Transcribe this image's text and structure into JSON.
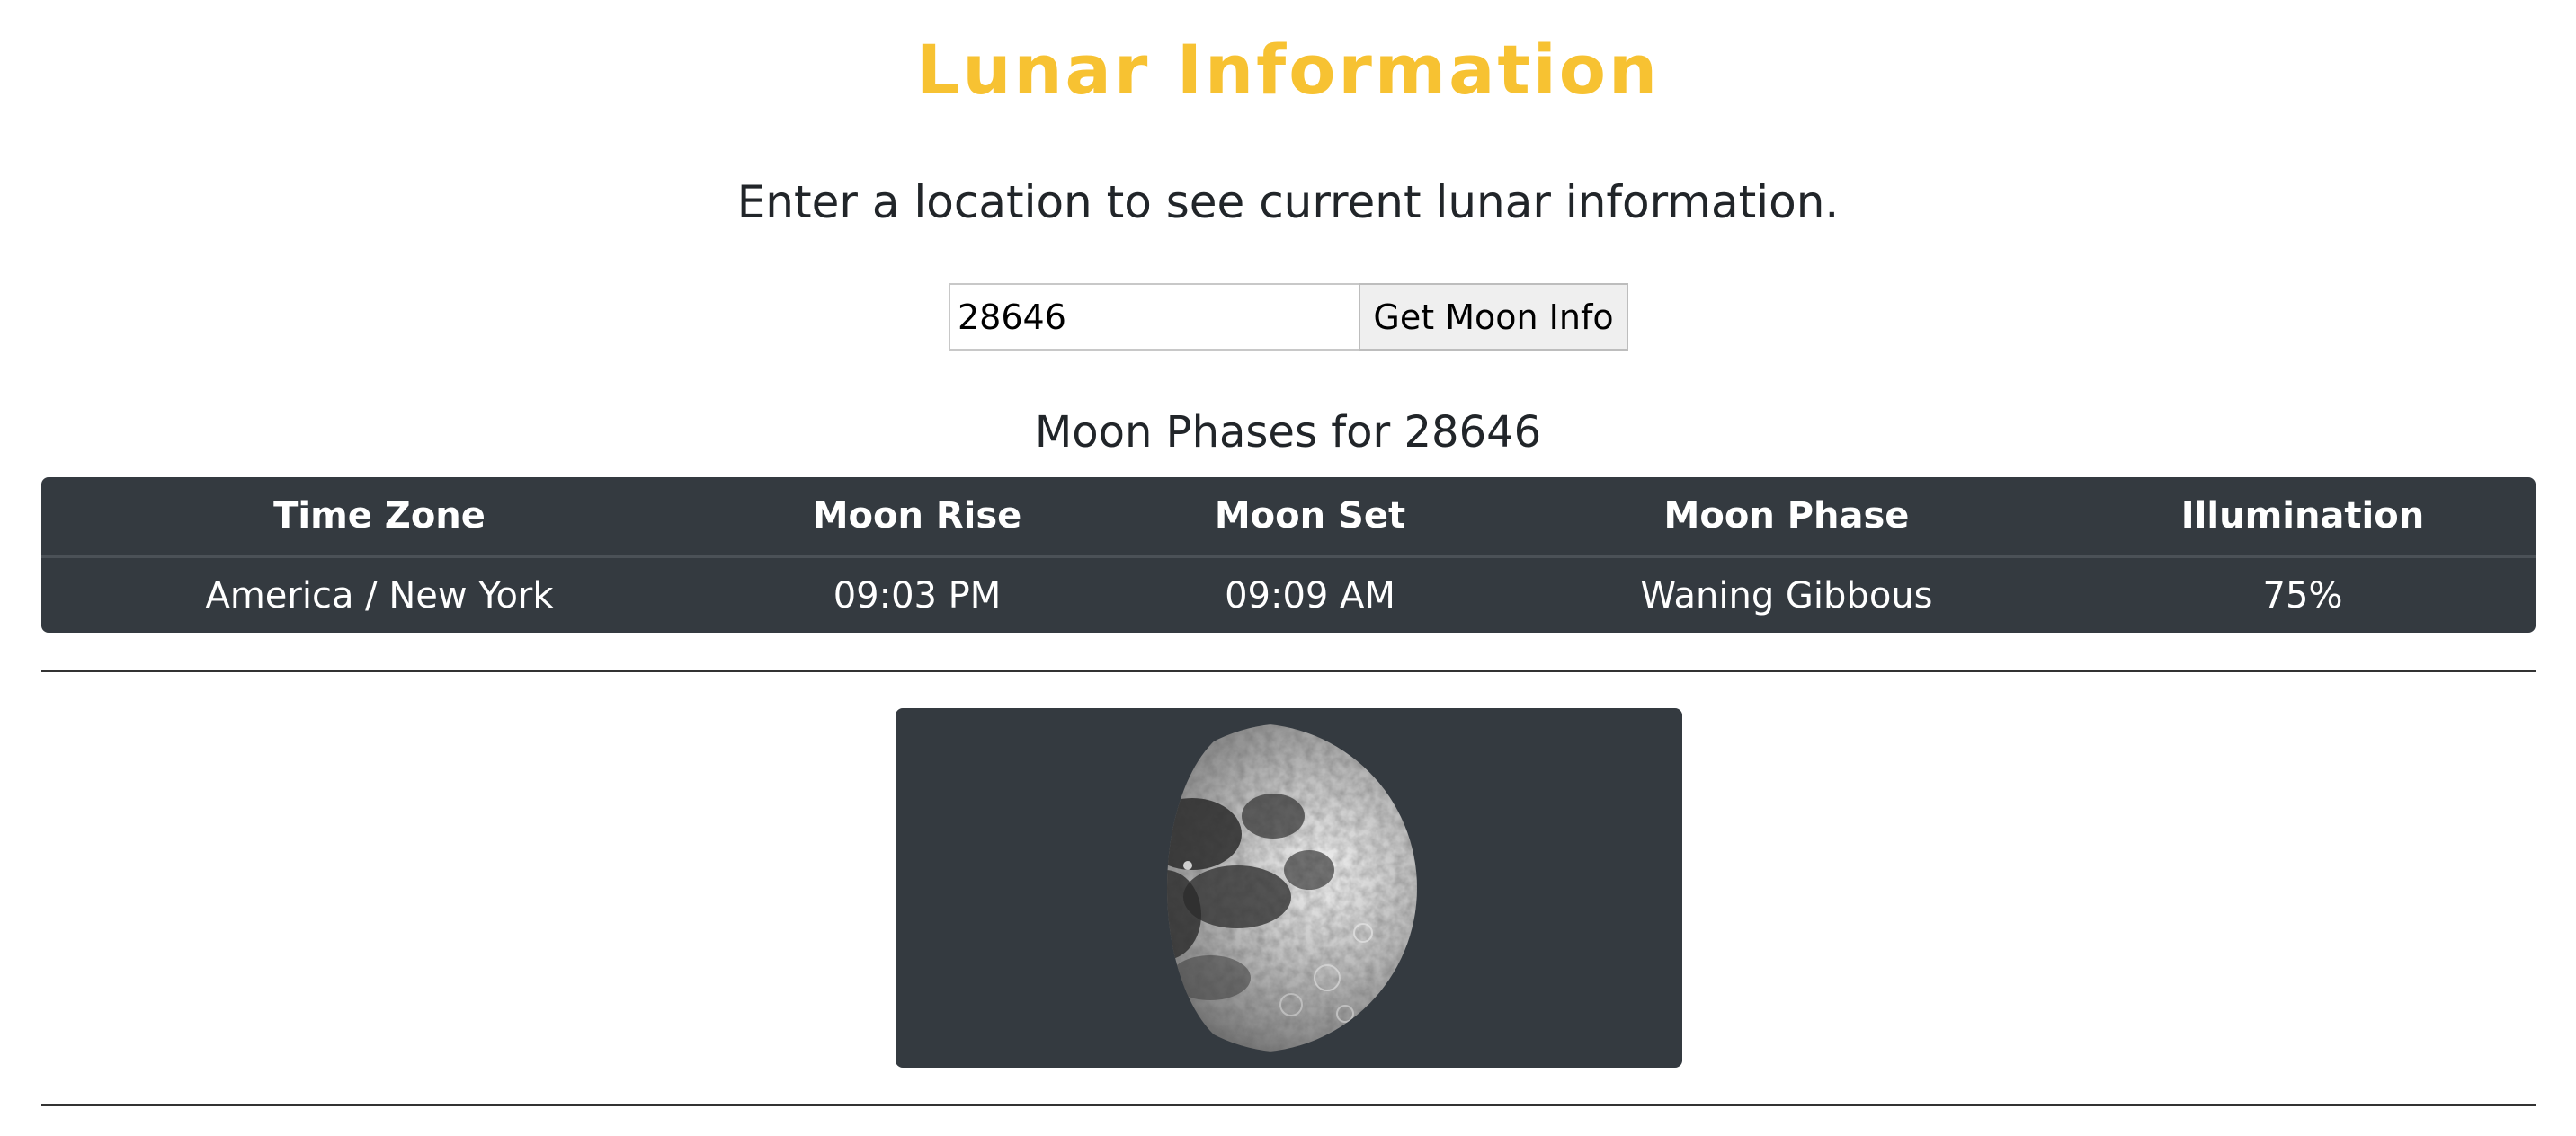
{
  "header": {
    "title": "Lunar Information"
  },
  "intro": {
    "text": "Enter a location to see current lunar information."
  },
  "search": {
    "value": "28646",
    "placeholder": "",
    "button_label": "Get Moon Info"
  },
  "results": {
    "title": "Moon Phases for 28646",
    "columns": [
      "Time Zone",
      "Moon Rise",
      "Moon Set",
      "Moon Phase",
      "Illumination"
    ],
    "row": {
      "time_zone": "America / New York",
      "moon_rise": "09:03 PM",
      "moon_set": "09:09 AM",
      "moon_phase": "Waning Gibbous",
      "illumination": "75%"
    }
  },
  "moon_image": {
    "phase": "waning-gibbous",
    "illumination_fraction": 0.75
  },
  "colors": {
    "title": "#f7c232",
    "table_bg": "#343a40",
    "panel_bg": "#343a40"
  }
}
